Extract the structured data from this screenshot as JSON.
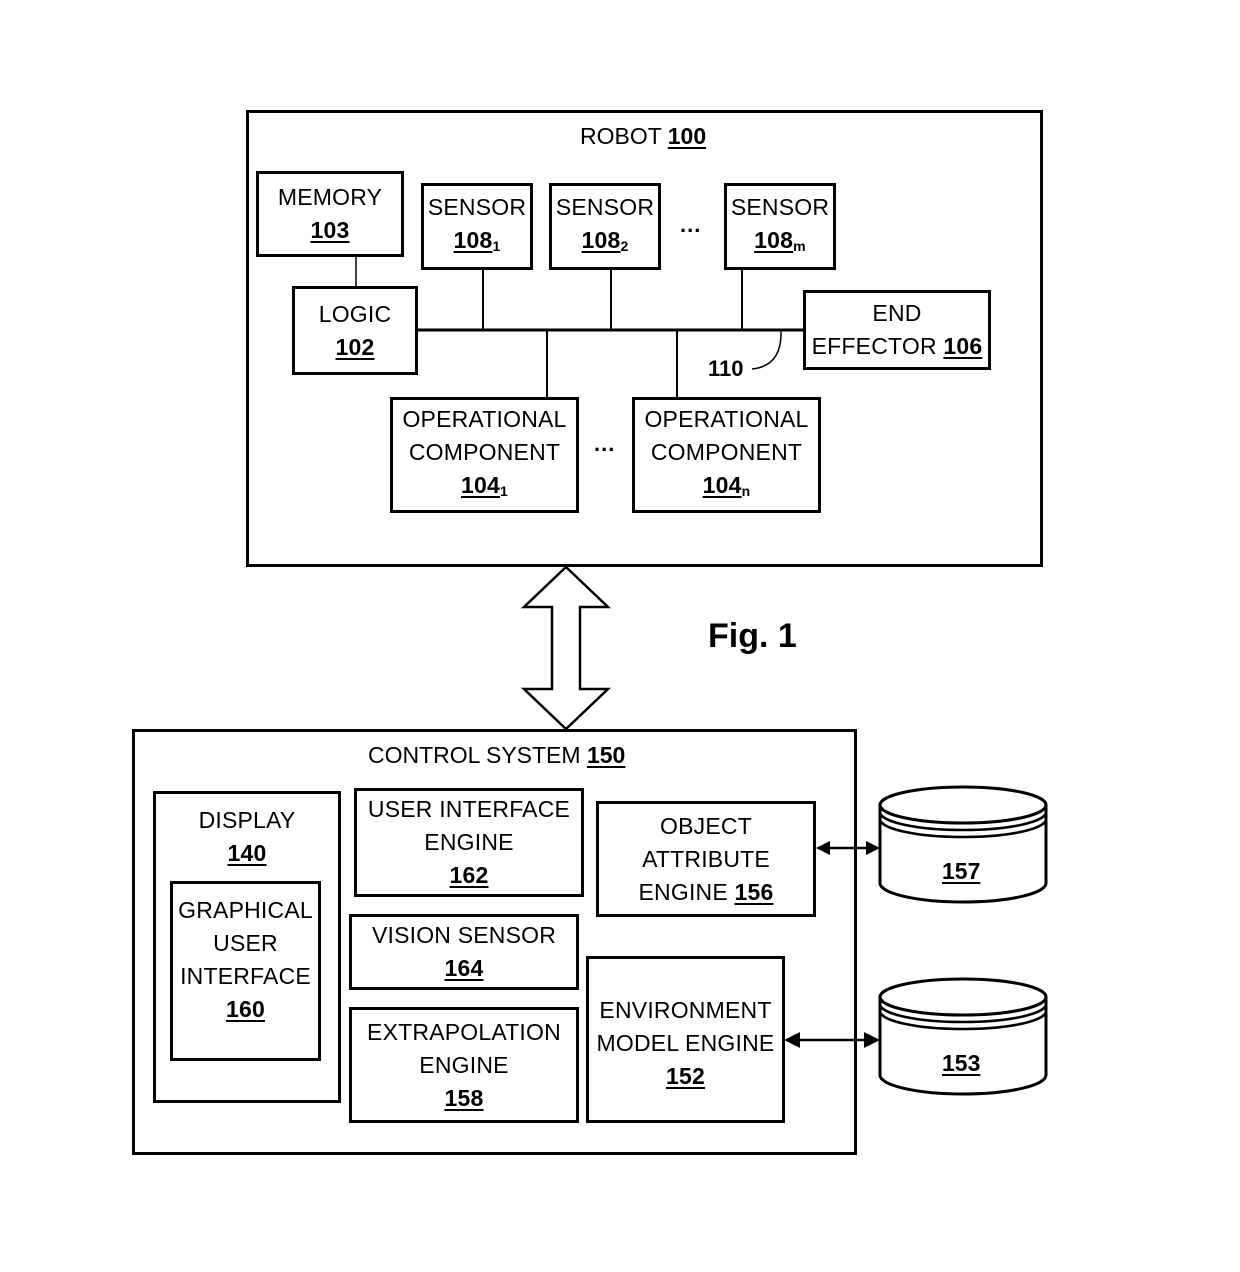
{
  "figure_label": "Fig. 1",
  "robot": {
    "title": "ROBOT",
    "number": "100",
    "memory": {
      "label": "MEMORY",
      "number": "103"
    },
    "logic": {
      "label": "LOGIC",
      "number": "102"
    },
    "sensors": [
      {
        "label": "SENSOR",
        "number": "108",
        "subscript": "1"
      },
      {
        "label": "SENSOR",
        "number": "108",
        "subscript": "2"
      },
      {
        "label": "SENSOR",
        "number": "108",
        "subscript": "m"
      }
    ],
    "sensor_ellipsis": "...",
    "end_effector": {
      "label_line1": "END",
      "label_line2": "EFFECTOR",
      "number": "106"
    },
    "bus": {
      "number": "110"
    },
    "operational_components": [
      {
        "label_line1": "OPERATIONAL",
        "label_line2": "COMPONENT",
        "number": "104",
        "subscript": "1"
      },
      {
        "label_line1": "OPERATIONAL",
        "label_line2": "COMPONENT",
        "number": "104",
        "subscript": "n"
      }
    ],
    "component_ellipsis": "..."
  },
  "control_system": {
    "title": "CONTROL SYSTEM",
    "number": "150",
    "display": {
      "label": "DISPLAY",
      "number": "140"
    },
    "gui": {
      "label_line1": "GRAPHICAL",
      "label_line2": "USER",
      "label_line3": "INTERFACE",
      "number": "160"
    },
    "ui_engine": {
      "label_line1": "USER INTERFACE",
      "label_line2": "ENGINE",
      "number": "162"
    },
    "vision_sensor": {
      "label": "VISION SENSOR",
      "number": "164"
    },
    "extrapolation_engine": {
      "label_line1": "EXTRAPOLATION",
      "label_line2": "ENGINE",
      "number": "158"
    },
    "object_attribute_engine": {
      "label_line1": "OBJECT",
      "label_line2": "ATTRIBUTE",
      "label_line3": "ENGINE",
      "number": "156"
    },
    "environment_model_engine": {
      "label_line1": "ENVIRONMENT",
      "label_line2": "MODEL ENGINE",
      "number": "152"
    }
  },
  "databases": [
    {
      "number": "157"
    },
    {
      "number": "153"
    }
  ]
}
